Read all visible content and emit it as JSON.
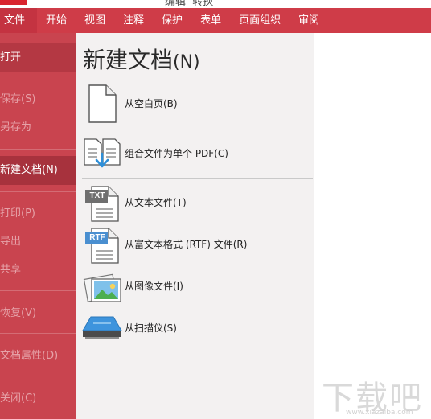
{
  "window": {
    "title": "编辑  转换"
  },
  "ribbon": {
    "tabs": [
      "文件",
      "开始",
      "视图",
      "注释",
      "保护",
      "表单",
      "页面组织",
      "审阅"
    ]
  },
  "backstage": {
    "items": [
      {
        "label": "打开",
        "state": "normal"
      },
      {
        "label": "保存(S)",
        "state": "disabled"
      },
      {
        "label": "另存为",
        "state": "disabled"
      },
      {
        "label": "新建文档(N)",
        "state": "selected"
      },
      {
        "label": "打印(P)",
        "state": "disabled"
      },
      {
        "label": "导出",
        "state": "disabled"
      },
      {
        "label": "共享",
        "state": "disabled"
      },
      {
        "label": "恢复(V)",
        "state": "disabled"
      },
      {
        "label": "文档属性(D)",
        "state": "disabled"
      },
      {
        "label": "关闭(C)",
        "state": "disabled"
      }
    ]
  },
  "panel": {
    "title": "新建文档",
    "title_suffix": "(N)",
    "entries": [
      {
        "label": "从空白页(B)",
        "icon": "blank-page-icon"
      },
      {
        "label": "组合文件为单个 PDF(C)",
        "icon": "combine-files-icon"
      },
      {
        "label": "从文本文件(T)",
        "icon": "txt-file-icon",
        "badge": "TXT"
      },
      {
        "label": "从富文本格式 (RTF) 文件(R)",
        "icon": "rtf-file-icon",
        "badge": "RTF"
      },
      {
        "label": "从图像文件(I)",
        "icon": "image-file-icon"
      },
      {
        "label": "从扫描仪(S)",
        "icon": "scanner-icon"
      }
    ]
  },
  "watermark": {
    "text": "下载吧",
    "url": "www.xiazaiba.com"
  },
  "colors": {
    "ribbon": "#cf3c48",
    "sidebar": "#c9444f",
    "selected": "#a7323d",
    "accent_blue": "#2f8fd8"
  }
}
